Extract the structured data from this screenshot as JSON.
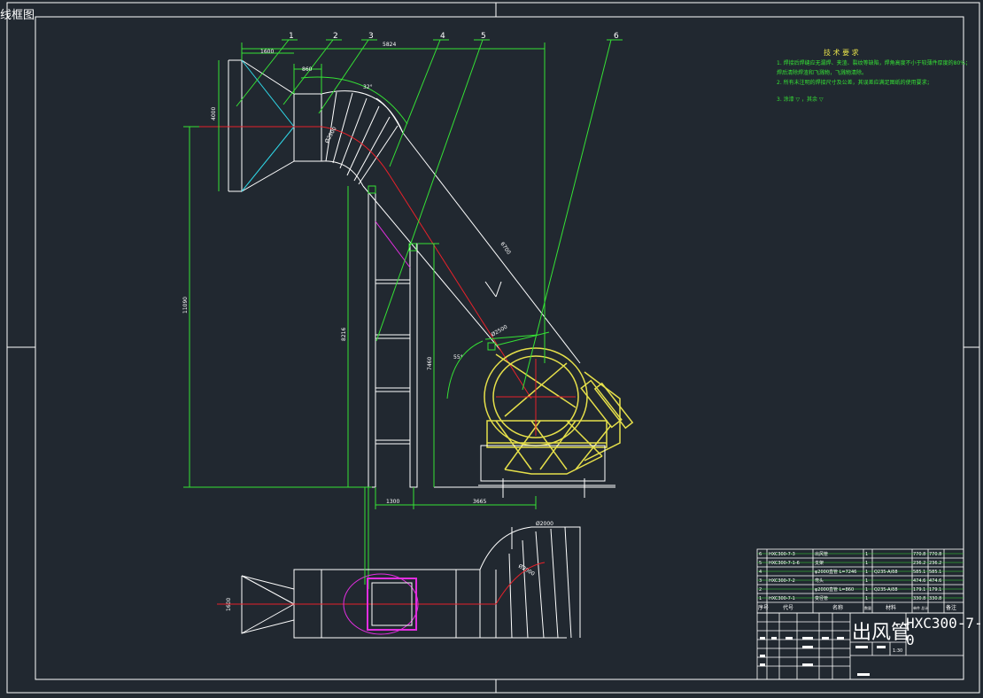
{
  "viewport": {
    "label": "线框图"
  },
  "colors": {
    "background": "#212830",
    "frame": "#ffffff",
    "green": "#35e235",
    "red": "#e8212a",
    "yellow": "#e6e04a",
    "cyan": "#2fd6e6",
    "magenta": "#e22ee0"
  },
  "callouts": [
    "1",
    "2",
    "3",
    "4",
    "5",
    "6"
  ],
  "dimensions": {
    "top_width": "5824",
    "inlet_width": "1600",
    "reducer_len": "860",
    "elbow_angle": "32°",
    "inlet_height": "4000",
    "elbow_dia": "Ø2500",
    "total_height": "11090",
    "support_height": "8216",
    "support_height_2": "7460",
    "leg_spacing": "1300",
    "leg_offset": "3665",
    "duct_len": "6700",
    "flange_dia": "Ø2500",
    "incline_angle": "55°",
    "plan_dia": "Ø2000",
    "plan_elbow": "Ø2000",
    "plan_width": "1600"
  },
  "notes": {
    "title": "技 术 要 求",
    "lines": [
      "1. 焊接后焊缝应无漏焊、夹渣、裂纹等缺陷，焊角高度不小于较薄件厚度的80%；",
      "   焊后清除焊渣和飞溅物，飞溅物清除。",
      "2. 所有未注明的焊接尺寸及公差，其误差应满足图纸的使用要求；",
      "3. 涂漆 ▽  ，其余 ▽"
    ]
  },
  "bom": {
    "rows": [
      {
        "no": "6",
        "code": "HXC300-7-3",
        "name": "出风管",
        "qty": "1",
        "material": "",
        "w1": "770.8",
        "w2": "770.8"
      },
      {
        "no": "5",
        "code": "HXC300-7-1-6",
        "name": "支架",
        "qty": "1",
        "material": "",
        "w1": "236.2",
        "w2": "236.2"
      },
      {
        "no": "4",
        "code": "",
        "name": "φ2000直管  L=7246",
        "qty": "1",
        "material": "Q235-A/δ8",
        "w1": "585.1",
        "w2": "585.1"
      },
      {
        "no": "3",
        "code": "HXC300-7-2",
        "name": "弯头",
        "qty": "1",
        "material": "",
        "w1": "474.6",
        "w2": "474.6"
      },
      {
        "no": "2",
        "code": "",
        "name": "φ2000直管  L=860",
        "qty": "1",
        "material": "Q235-A/δ8",
        "w1": "179.1",
        "w2": "179.1"
      },
      {
        "no": "1",
        "code": "HXC300-7-1",
        "name": "变径管",
        "qty": "1",
        "material": "",
        "w1": "330.8",
        "w2": "330.8"
      }
    ],
    "headers": {
      "no": "序号",
      "code": "代号",
      "name": "名称",
      "qty": "数量",
      "material": "材料",
      "weight": "单件 总计",
      "note": "备注"
    }
  },
  "title_block": {
    "title": "出风管",
    "drawing_no": "HXC300-7-0",
    "scale": "1:30"
  }
}
